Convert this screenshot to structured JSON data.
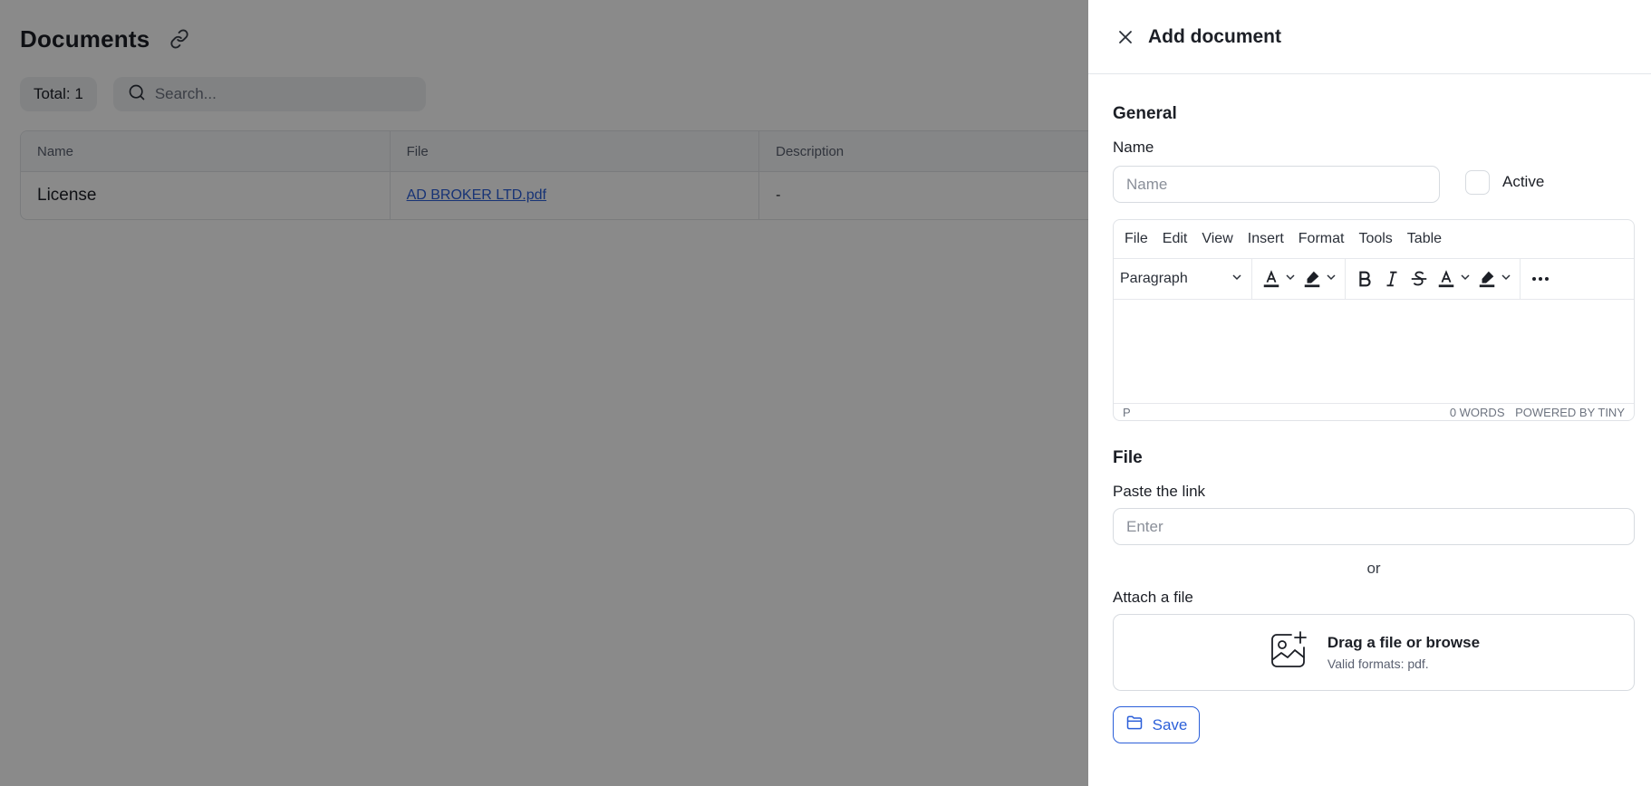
{
  "page": {
    "title": "Documents",
    "total_label": "Total: 1",
    "search_placeholder": "Search...",
    "table": {
      "columns": [
        "Name",
        "File",
        "Description"
      ],
      "rows": [
        {
          "name": "License",
          "file": "AD BROKER LTD.pdf",
          "description": "-"
        }
      ]
    }
  },
  "drawer": {
    "title": "Add document",
    "general_title": "General",
    "name_label": "Name",
    "name_placeholder": "Name",
    "active_label": "Active",
    "active_checked": false,
    "editor": {
      "menu": [
        "File",
        "Edit",
        "View",
        "Insert",
        "Format",
        "Tools",
        "Table"
      ],
      "block_format": "Paragraph",
      "status_path": "P",
      "word_count": "0 WORDS",
      "branding": "POWERED BY TINY"
    },
    "file_title": "File",
    "paste_label": "Paste the link",
    "paste_placeholder": "Enter",
    "or_text": "or",
    "attach_label": "Attach a file",
    "dropzone_title": "Drag a file or browse",
    "dropzone_sub": "Valid formats: pdf.",
    "save_label": "Save"
  },
  "colors": {
    "accent": "#2b5fd9",
    "overlay": "rgba(0,0,0,0.46)",
    "text": "#1c1f26"
  }
}
